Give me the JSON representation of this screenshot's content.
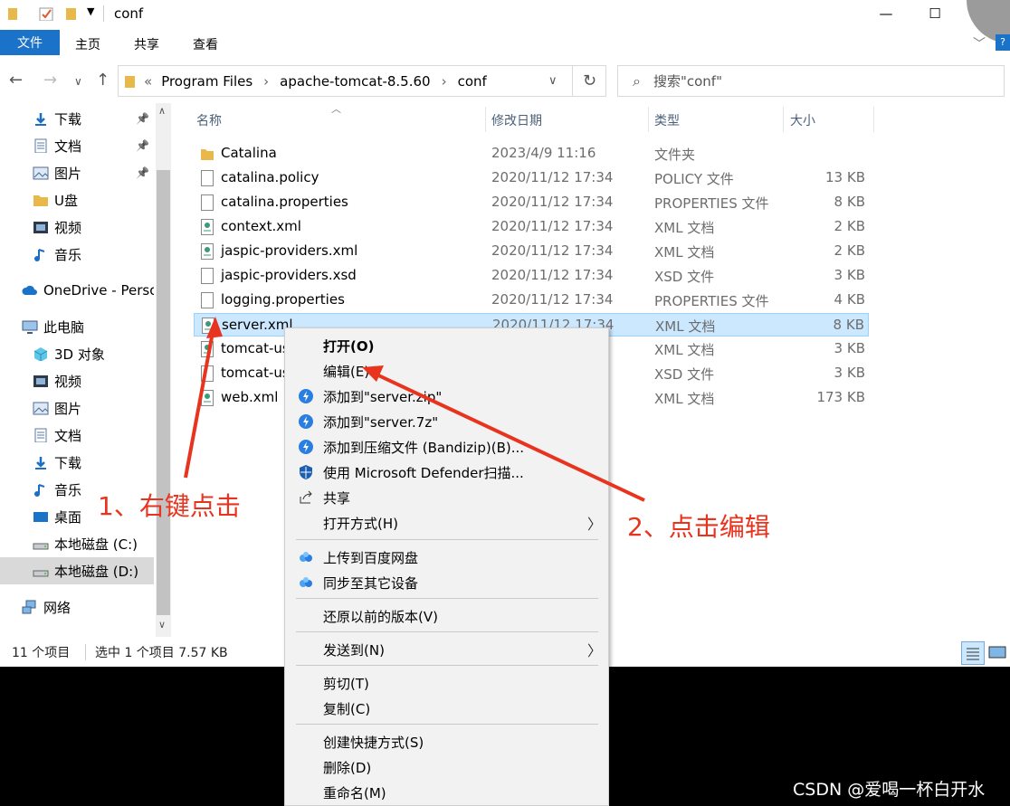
{
  "window": {
    "title": "conf"
  },
  "ribbon": {
    "tabs": [
      "文件",
      "主页",
      "共享",
      "查看"
    ]
  },
  "address": {
    "parts": [
      "Program Files",
      "apache-tomcat-8.5.60",
      "conf"
    ],
    "overflow": "«"
  },
  "search": {
    "placeholder": "搜索\"conf\""
  },
  "sidebar": {
    "items": [
      {
        "label": "下载",
        "icon": "download-icon",
        "pinned": true
      },
      {
        "label": "文档",
        "icon": "document-icon",
        "pinned": true
      },
      {
        "label": "图片",
        "icon": "picture-icon",
        "pinned": true
      },
      {
        "label": "U盘",
        "icon": "folder-icon",
        "pinned": false
      },
      {
        "label": "视频",
        "icon": "video-icon",
        "pinned": false
      },
      {
        "label": "音乐",
        "icon": "music-icon",
        "pinned": false
      },
      {
        "label": "OneDrive - Perso",
        "icon": "cloud-icon",
        "pinned": false
      },
      {
        "label": "此电脑",
        "icon": "computer-icon",
        "pinned": false
      },
      {
        "label": "3D 对象",
        "icon": "cube-icon",
        "pinned": false
      },
      {
        "label": "视频",
        "icon": "video-icon",
        "pinned": false
      },
      {
        "label": "图片",
        "icon": "picture-icon",
        "pinned": false
      },
      {
        "label": "文档",
        "icon": "document-icon",
        "pinned": false
      },
      {
        "label": "下载",
        "icon": "download-icon",
        "pinned": false
      },
      {
        "label": "音乐",
        "icon": "music-icon",
        "pinned": false
      },
      {
        "label": "桌面",
        "icon": "desktop-icon",
        "pinned": false
      },
      {
        "label": "本地磁盘 (C:)",
        "icon": "drive-icon",
        "pinned": false
      },
      {
        "label": "本地磁盘 (D:)",
        "icon": "drive-icon",
        "pinned": false,
        "selected": true
      },
      {
        "label": "网络",
        "icon": "network-icon",
        "pinned": false
      }
    ]
  },
  "columns": [
    "名称",
    "修改日期",
    "类型",
    "大小"
  ],
  "files": [
    {
      "name": "Catalina",
      "date": "2023/4/9 11:16",
      "type": "文件夹",
      "size": "",
      "icon": "folder-icon"
    },
    {
      "name": "catalina.policy",
      "date": "2020/11/12 17:34",
      "type": "POLICY 文件",
      "size": "13 KB",
      "icon": "file-icon"
    },
    {
      "name": "catalina.properties",
      "date": "2020/11/12 17:34",
      "type": "PROPERTIES 文件",
      "size": "8 KB",
      "icon": "file-icon"
    },
    {
      "name": "context.xml",
      "date": "2020/11/12 17:34",
      "type": "XML 文档",
      "size": "2 KB",
      "icon": "xml-icon"
    },
    {
      "name": "jaspic-providers.xml",
      "date": "2020/11/12 17:34",
      "type": "XML 文档",
      "size": "2 KB",
      "icon": "xml-icon"
    },
    {
      "name": "jaspic-providers.xsd",
      "date": "2020/11/12 17:34",
      "type": "XSD 文件",
      "size": "3 KB",
      "icon": "file-icon"
    },
    {
      "name": "logging.properties",
      "date": "2020/11/12 17:34",
      "type": "PROPERTIES 文件",
      "size": "4 KB",
      "icon": "file-icon"
    },
    {
      "name": "server.xml",
      "date": "2020/11/12 17:34",
      "type": "XML 文档",
      "size": "8 KB",
      "icon": "xml-icon",
      "selected": true
    },
    {
      "name": "tomcat-us",
      "date": "",
      "type": "XML 文档",
      "size": "3 KB",
      "icon": "xml-icon"
    },
    {
      "name": "tomcat-us",
      "date": "",
      "type": "XSD 文件",
      "size": "3 KB",
      "icon": "file-icon"
    },
    {
      "name": "web.xml",
      "date": "",
      "type": "XML 文档",
      "size": "173 KB",
      "icon": "xml-icon"
    }
  ],
  "status": {
    "count": "11 个项目",
    "selection": "选中 1 个项目  7.57 KB"
  },
  "context_menu": {
    "items": [
      {
        "label": "打开(O)",
        "bold": true
      },
      {
        "label": "编辑(E)"
      },
      {
        "label": "添加到\"server.zip\"",
        "icon": "bandizip-icon"
      },
      {
        "label": "添加到\"server.7z\"",
        "icon": "bandizip-icon"
      },
      {
        "label": "添加到压缩文件 (Bandizip)(B)...",
        "icon": "bandizip-icon"
      },
      {
        "label": "使用 Microsoft Defender扫描...",
        "icon": "defender-shield-icon"
      },
      {
        "label": "共享",
        "icon": "share-icon"
      },
      {
        "label": "打开方式(H)",
        "submenu": true
      },
      {
        "label": "上传到百度网盘",
        "icon": "baidu-cloud-icon"
      },
      {
        "label": "同步至其它设备",
        "icon": "baidu-cloud-icon"
      },
      {
        "label": "还原以前的版本(V)"
      },
      {
        "label": "发送到(N)",
        "submenu": true
      },
      {
        "label": "剪切(T)"
      },
      {
        "label": "复制(C)"
      },
      {
        "label": "创建快捷方式(S)"
      },
      {
        "label": "删除(D)"
      },
      {
        "label": "重命名(M)"
      }
    ]
  },
  "annotations": {
    "step1": "1、右键点击",
    "step2": "2、点击编辑",
    "color": "#e8331f"
  },
  "watermark": "CSDN @爱喝一杯白开水",
  "colors": {
    "accent": "#1a73c8",
    "selection": "#cce8ff"
  }
}
